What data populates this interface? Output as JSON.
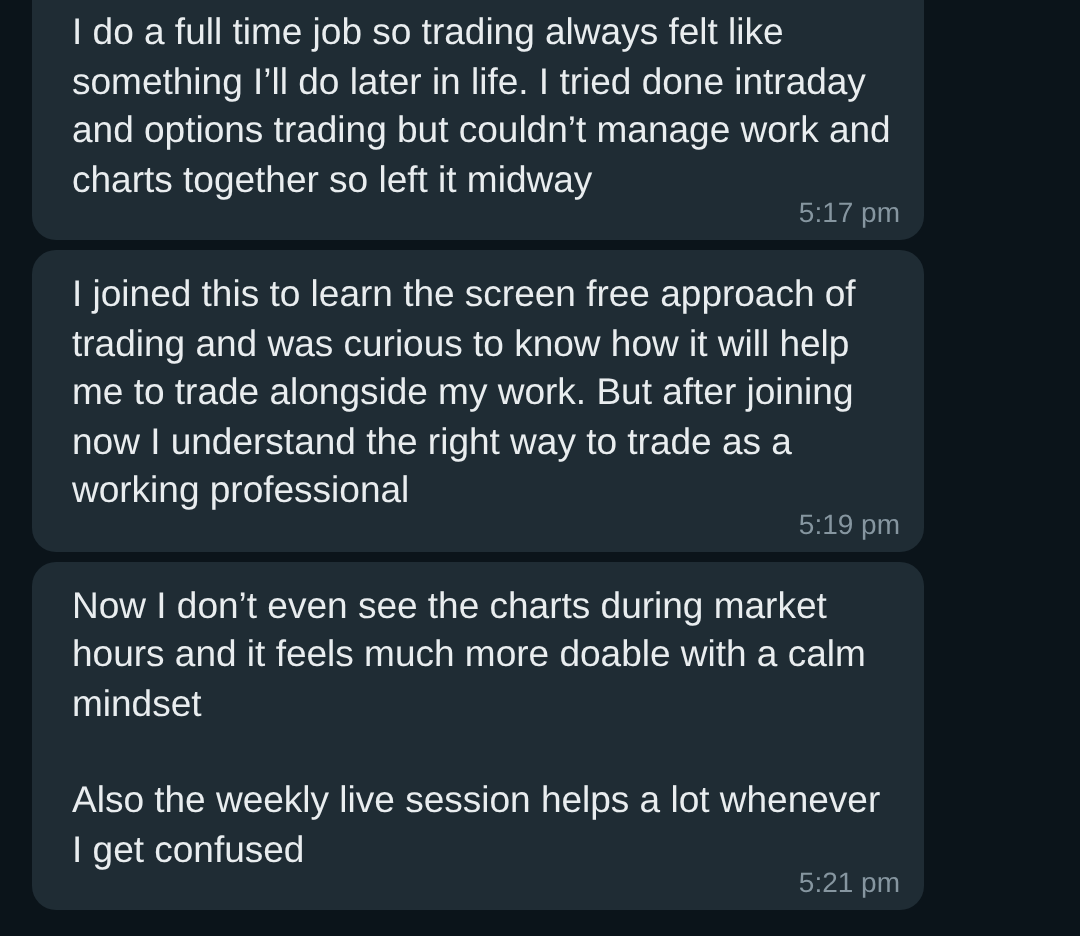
{
  "messages": [
    {
      "paragraphs": [
        "I do a full time job so trading always felt like something I’ll do later in life. I tried done intraday and options trading but couldn’t manage work and charts together so left it midway"
      ],
      "time": "5:17 pm"
    },
    {
      "paragraphs": [
        "I joined this to learn the screen free approach of trading and was curious to know how it will help me to trade alongside my work. But after joining now I understand the right way to trade as a working professional"
      ],
      "time": "5:19 pm"
    },
    {
      "paragraphs": [
        "Now I don’t even see the charts during market hours and it feels much more doable with a calm mindset",
        "Also the weekly live session helps a lot whenever I get confused"
      ],
      "time": "5:21 pm"
    }
  ]
}
